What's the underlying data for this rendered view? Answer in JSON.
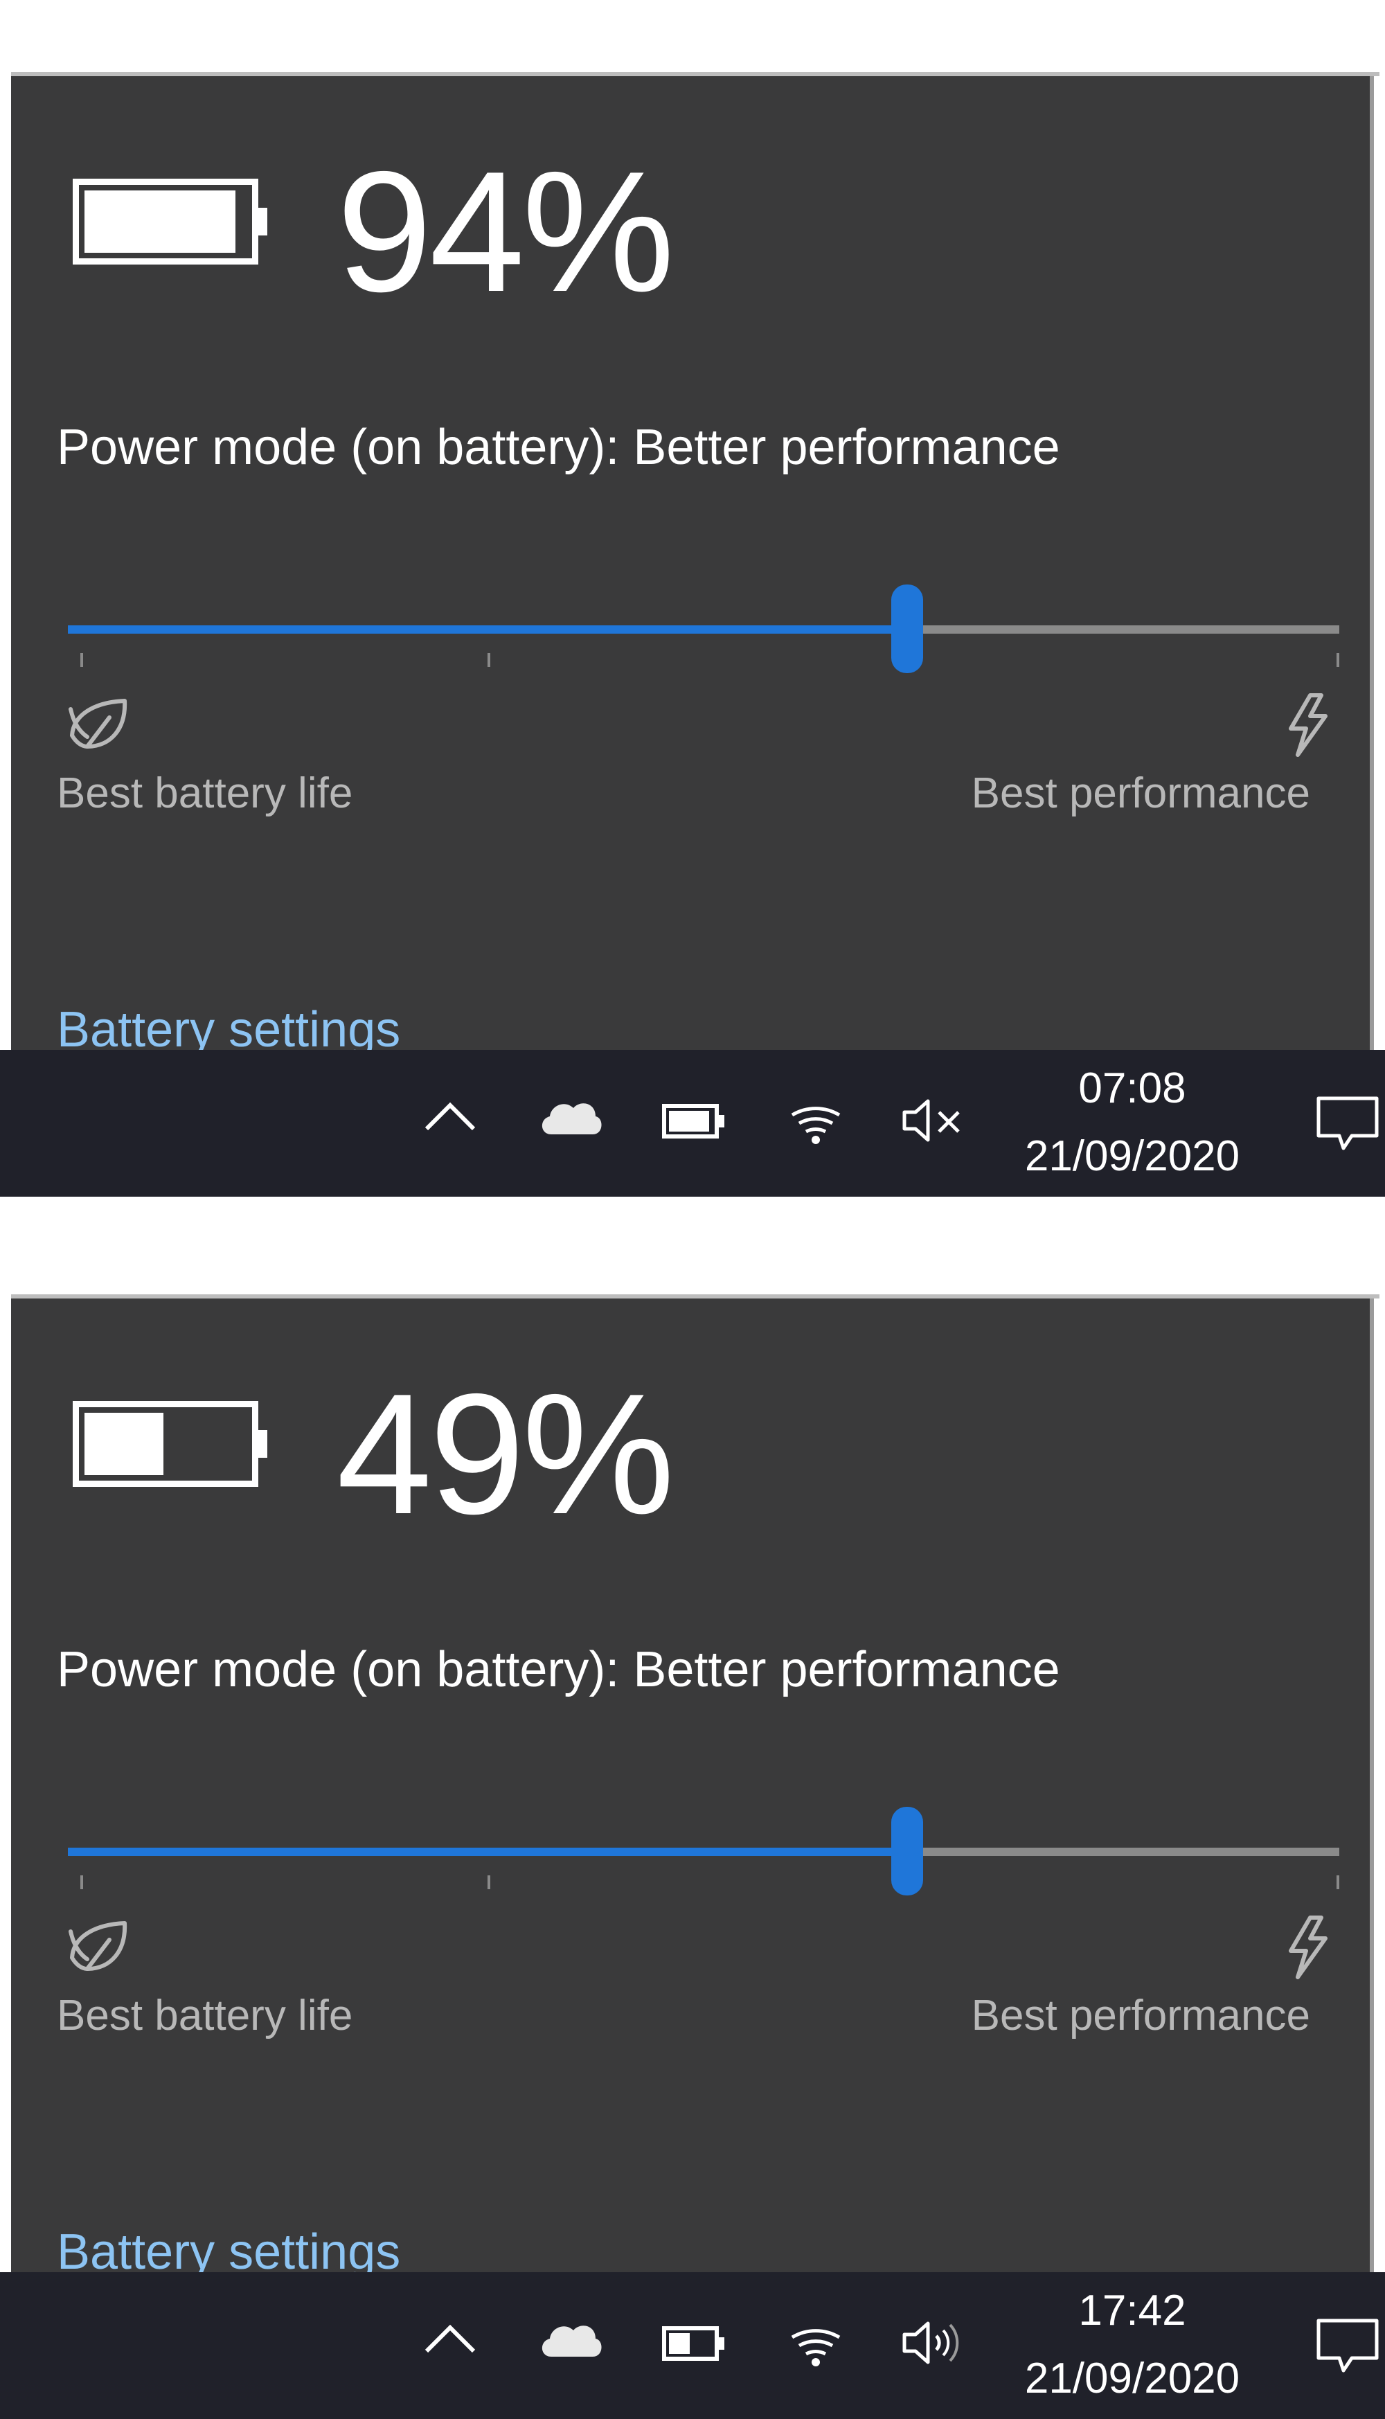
{
  "screenshots": [
    {
      "battery_percent_text": "94%",
      "battery_level": 0.94,
      "power_mode_label": "Power mode (on battery): Better performance",
      "slider": {
        "value": 0.66,
        "ticks": [
          0,
          0.33,
          1
        ]
      },
      "left_end_label": "Best battery life",
      "right_end_label": "Best performance",
      "settings_link": "Battery settings",
      "taskbar": {
        "time": "07:08",
        "date": "21/09/2020",
        "volume_state": "muted"
      }
    },
    {
      "battery_percent_text": "49%",
      "battery_level": 0.49,
      "power_mode_label": "Power mode (on battery): Better performance",
      "slider": {
        "value": 0.66,
        "ticks": [
          0,
          0.33,
          1
        ]
      },
      "left_end_label": "Best battery life",
      "right_end_label": "Best performance",
      "settings_link": "Battery settings",
      "taskbar": {
        "time": "17:42",
        "date": "21/09/2020",
        "volume_state": "on"
      }
    }
  ],
  "icons": {
    "battery": "battery-icon",
    "leaf": "battery-saver-leaf-icon",
    "bolt": "performance-bolt-icon",
    "chevron": "show-hidden-icons-chevron-icon",
    "cloud": "onedrive-cloud-icon",
    "wifi": "wifi-icon",
    "volume_muted": "volume-muted-icon",
    "volume_on": "volume-icon",
    "notifications": "action-center-icon"
  },
  "colors": {
    "accent": "#1f76d9",
    "flyout_bg": "#3a3a3b",
    "taskbar_bg": "#20212a",
    "link": "#8dc4f3"
  }
}
